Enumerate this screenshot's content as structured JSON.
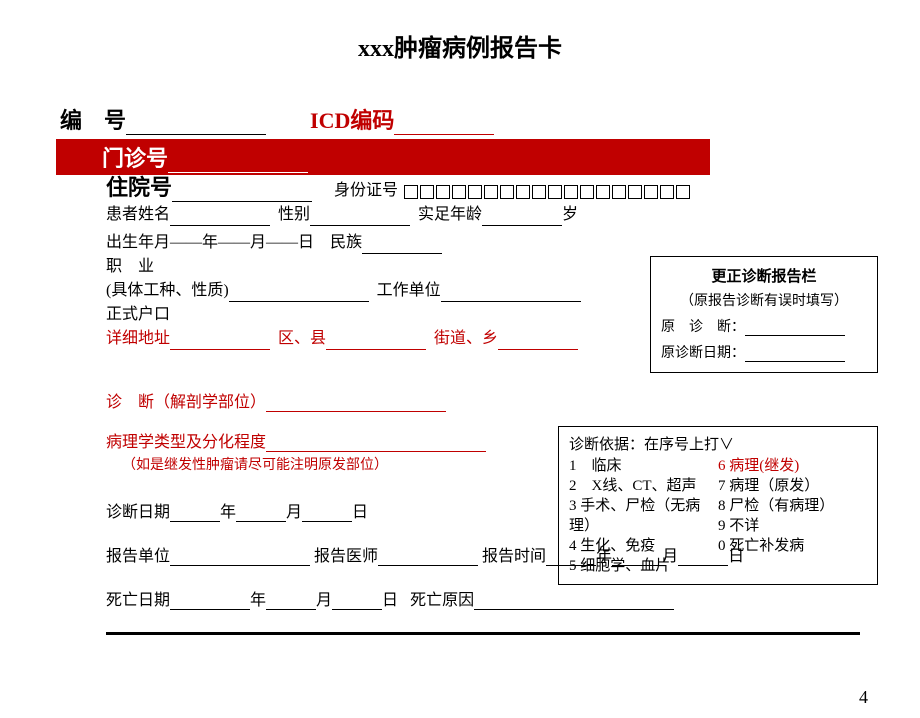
{
  "title": "xxx肿瘤病例报告卡",
  "line1": {
    "bianhao_label": "编　号",
    "icd_label": "ICD编码"
  },
  "menzhen_label": "门诊号",
  "zhuyuan_label": "住院号",
  "idcard_label": "身份证号",
  "patient": {
    "name_label": "患者姓名",
    "sex_label": "性别",
    "age_label": "实足年龄",
    "age_unit": "岁"
  },
  "birth": {
    "label": "出生年月",
    "y": "年",
    "m": "月",
    "d": "日",
    "ethnic_label": "民族"
  },
  "occupation_label": "职　业",
  "work_type_label": "(具体工种、性质)",
  "work_unit_label": "工作单位",
  "hukou_label": "正式户口",
  "address": {
    "label": "详细地址",
    "qu_label": "区、县",
    "jie_label": "街道、乡"
  },
  "correction": {
    "title": "更正诊断报告栏",
    "subtitle": "（原报告诊断有误时填写）",
    "orig_diag": "原　诊　断：",
    "orig_date": "原诊断日期："
  },
  "diagnosis": {
    "label": "诊　断（解剖学部位）"
  },
  "pathology": {
    "label": "病理学类型及分化程度",
    "note": "（如是继发性肿瘤请尽可能注明原发部位）"
  },
  "basis": {
    "title": "诊断依据：在序号上打∨",
    "items_left": [
      "1　临床",
      "2　X线、CT、超声",
      "3 手术、尸检（无病理）",
      "4 生化、免疫",
      "5 细胞学、血片"
    ],
    "items_right": [
      "6 病理(继发)",
      "7 病理（原发）",
      "8 尸检（有病理）",
      "9 不详",
      "0 死亡补发病"
    ]
  },
  "diag_date": {
    "label": "诊断日期",
    "y": "年",
    "m": "月",
    "d": "日"
  },
  "report": {
    "unit_label": "报告单位",
    "doctor_label": "报告医师",
    "time_label": "报告时间",
    "y": "年",
    "m": "月",
    "d": "日"
  },
  "death": {
    "date_label": "死亡日期",
    "y": "年",
    "m": "月",
    "d": "日",
    "cause_label": "死亡原因"
  },
  "page_num": "4"
}
